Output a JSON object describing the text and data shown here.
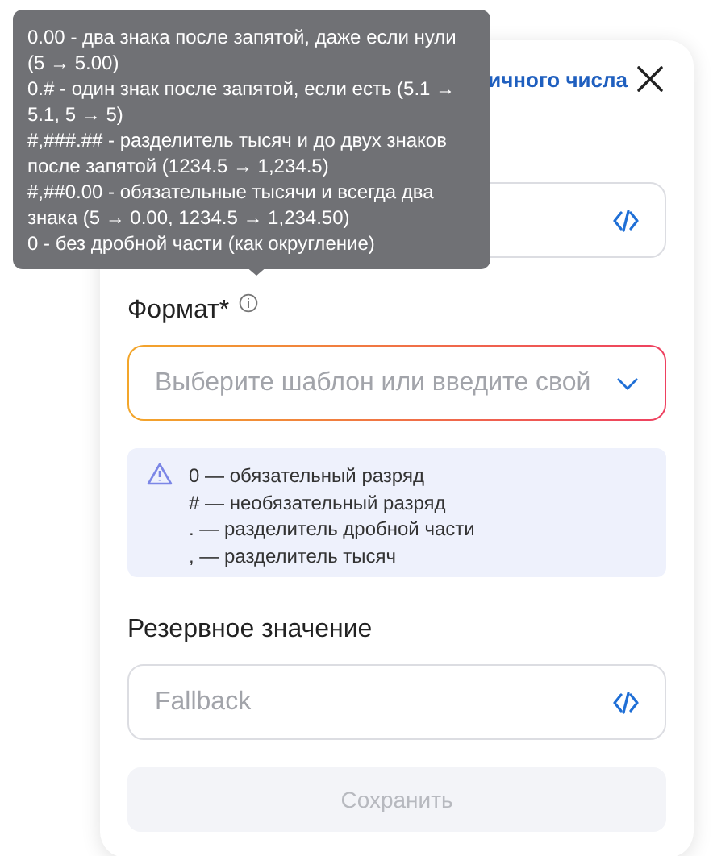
{
  "dialog": {
    "title": "ичного числа"
  },
  "format_field": {
    "label": "Формат*",
    "placeholder": "Выберите шаблон или введите свой",
    "focused": true
  },
  "hint": {
    "lines": [
      "0 — обязательный разряд",
      "# — необязательный разряд",
      ". — разделитель дробной части",
      ", — разделитель тысяч"
    ]
  },
  "fallback_field": {
    "label": "Резервное значение",
    "placeholder": "Fallback"
  },
  "save_button": {
    "label": "Сохранить",
    "disabled": true
  },
  "tooltip": {
    "lines": [
      "0.00 - два знака после запятой, даже если нули (5 → 5.00)",
      "0.# - один знак после запятой, если есть (5.1 → 5.1, 5 → 5)",
      "#,###.## - разделитель тысяч и до двух знаков после запятой (1234.5 → 1,234.5)",
      "#,##0.00 - обязательные тысячи и всегда два знака (5 → 0.00, 1234.5 → 1,234.50)",
      "0 - без дробной части (как округление)"
    ]
  }
}
